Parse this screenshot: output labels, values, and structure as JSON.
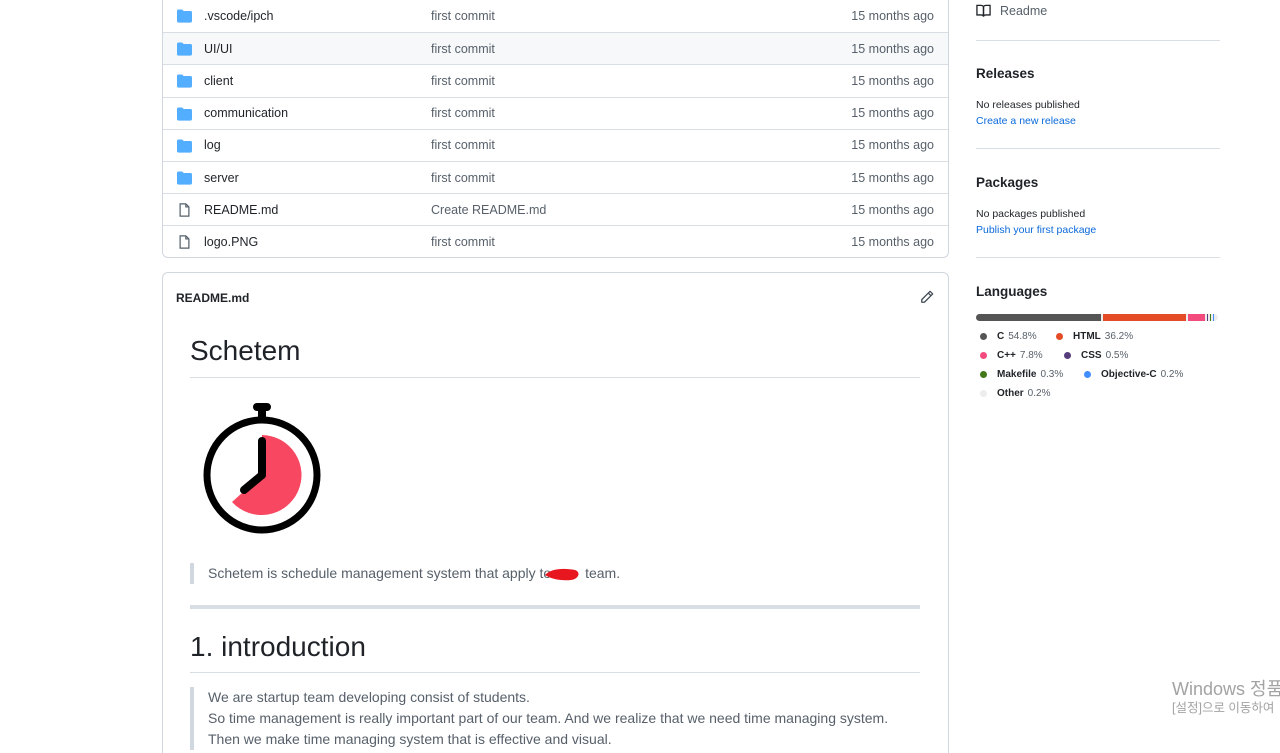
{
  "files": [
    {
      "name": ".vscode/ipch",
      "message": "first commit",
      "date": "15 months ago",
      "type": "dir"
    },
    {
      "name": "UI/UI",
      "message": "first commit",
      "date": "15 months ago",
      "type": "dir"
    },
    {
      "name": "client",
      "message": "first commit",
      "date": "15 months ago",
      "type": "dir"
    },
    {
      "name": "communication",
      "message": "first commit",
      "date": "15 months ago",
      "type": "dir"
    },
    {
      "name": "log",
      "message": "first commit",
      "date": "15 months ago",
      "type": "dir"
    },
    {
      "name": "server",
      "message": "first commit",
      "date": "15 months ago",
      "type": "dir"
    },
    {
      "name": "README.md",
      "message": "Create README.md",
      "date": "15 months ago",
      "type": "file"
    },
    {
      "name": "logo.PNG",
      "message": "first commit",
      "date": "15 months ago",
      "type": "file"
    }
  ],
  "readme": {
    "filename": "README.md",
    "title": "Schetem",
    "tagline_before": "Schetem is schedule management system that apply to",
    "tagline_after": "team.",
    "section1_title": "1. introduction",
    "intro_lines": [
      "We are startup team developing consist of students.",
      "So time management is really important part of our team. And we realize that we need time managing system.",
      "Then we make time managing system that is effective and visual."
    ]
  },
  "sidebar": {
    "readme_label": "Readme",
    "releases_title": "Releases",
    "releases_text": "No releases published",
    "releases_link": "Create a new release",
    "packages_title": "Packages",
    "packages_text": "No packages published",
    "packages_link": "Publish your first package",
    "languages_title": "Languages",
    "languages": [
      {
        "name": "C",
        "percent": "54.8%",
        "value": 54.8,
        "color": "#555555"
      },
      {
        "name": "HTML",
        "percent": "36.2%",
        "value": 36.2,
        "color": "#e34c26"
      },
      {
        "name": "C++",
        "percent": "7.8%",
        "value": 7.8,
        "color": "#f34b7d"
      },
      {
        "name": "CSS",
        "percent": "0.5%",
        "value": 0.5,
        "color": "#563d7c"
      },
      {
        "name": "Makefile",
        "percent": "0.3%",
        "value": 0.3,
        "color": "#427819"
      },
      {
        "name": "Objective-C",
        "percent": "0.2%",
        "value": 0.2,
        "color": "#438eff"
      },
      {
        "name": "Other",
        "percent": "0.2%",
        "value": 0.2,
        "color": "#ededed"
      }
    ]
  },
  "watermark": {
    "line1": "Windows 정품",
    "line2": "[설정]으로 이동하여"
  }
}
